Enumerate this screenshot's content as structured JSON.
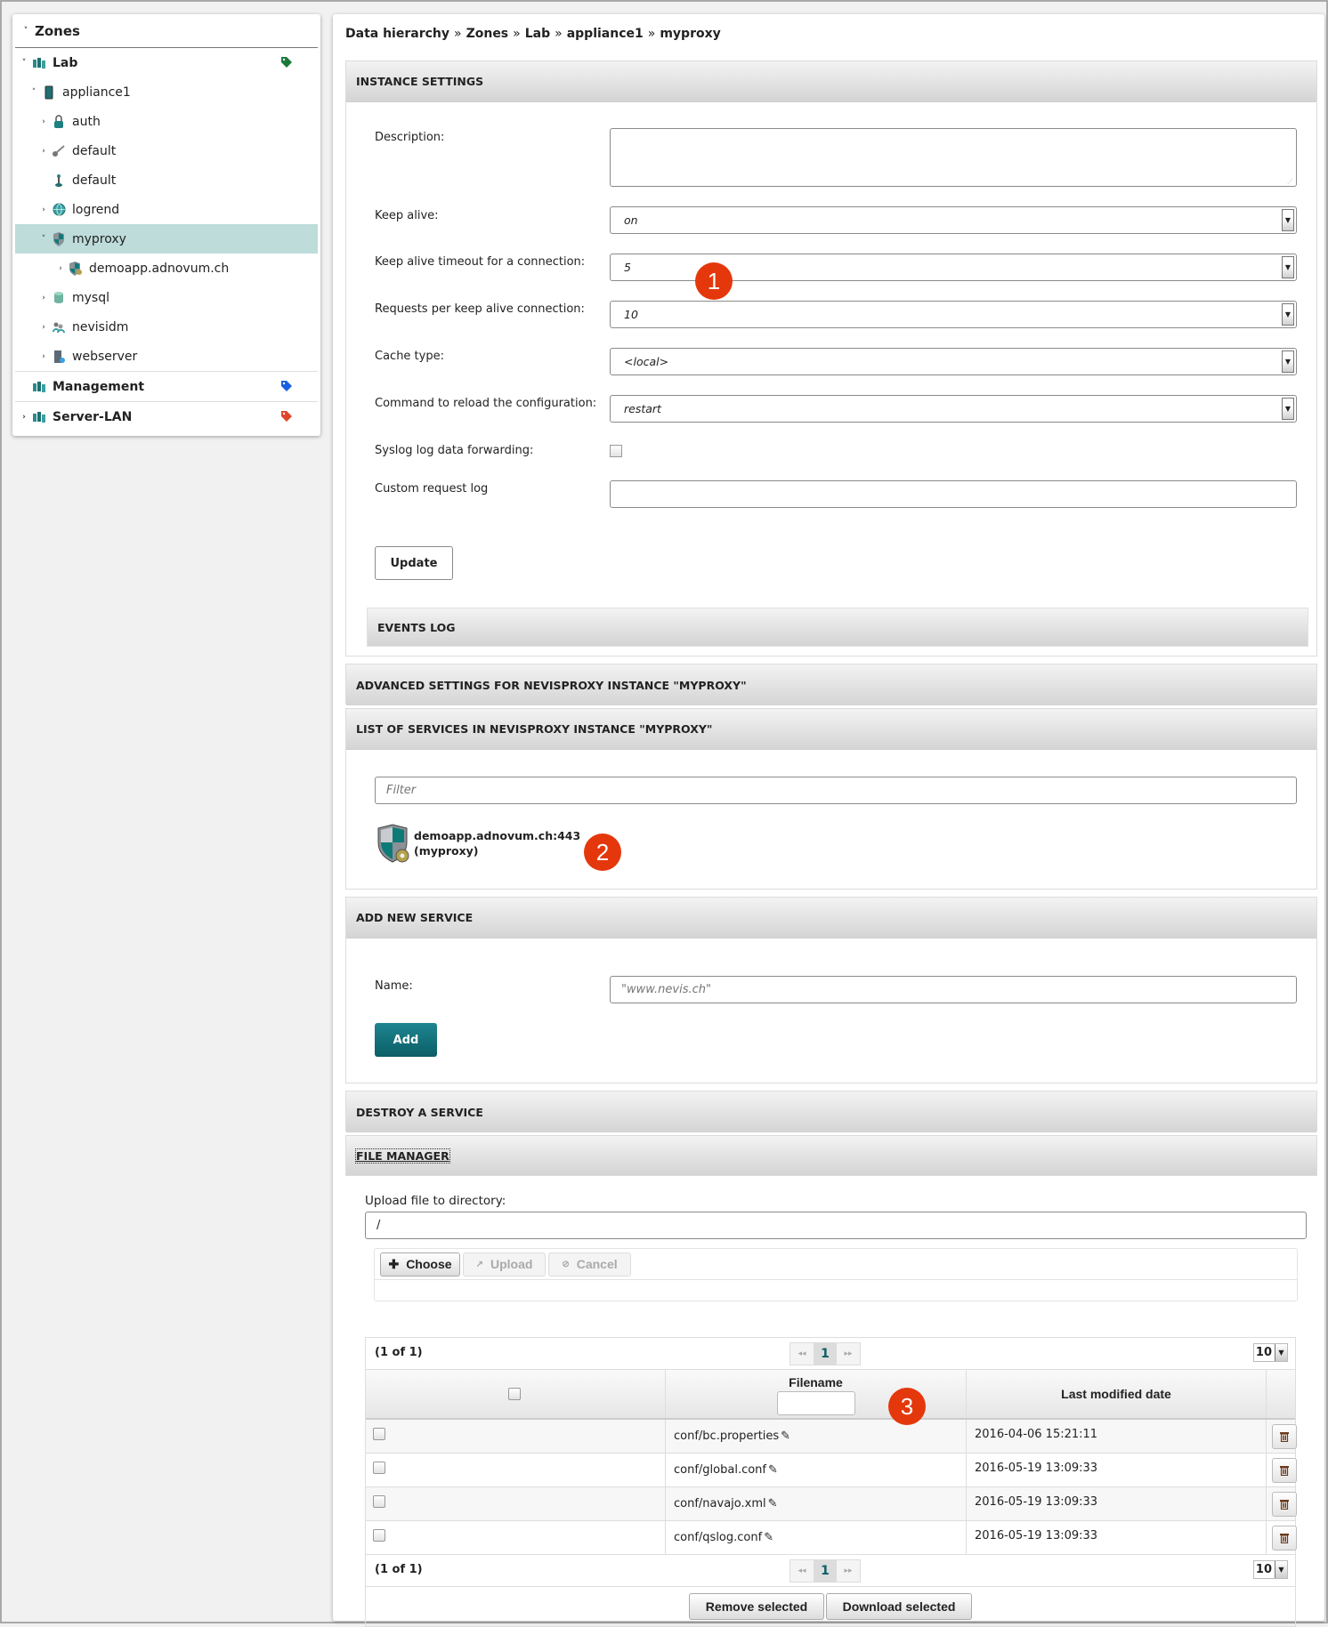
{
  "sidebar": {
    "title": "Zones",
    "items": [
      {
        "label": "Lab",
        "level": 0,
        "caret": "down",
        "icon": "zone-icon",
        "bold": true,
        "tag": "#1b7a3a"
      },
      {
        "label": "appliance1",
        "level": 1,
        "caret": "down",
        "icon": "appliance-icon"
      },
      {
        "label": "auth",
        "level": 2,
        "caret": "right",
        "icon": "lock-icon"
      },
      {
        "label": "default",
        "level": 2,
        "caret": "right",
        "icon": "key-icon"
      },
      {
        "label": "default",
        "level": 2,
        "caret": "",
        "icon": "joystick-icon"
      },
      {
        "label": "logrend",
        "level": 2,
        "caret": "right",
        "icon": "globe-icon"
      },
      {
        "label": "myproxy",
        "level": 2,
        "caret": "down",
        "icon": "shield-icon",
        "selected": true
      },
      {
        "label": "demoapp.adnovum.ch",
        "level": 3,
        "caret": "right",
        "icon": "shield-gear-icon"
      },
      {
        "label": "mysql",
        "level": 2,
        "caret": "right",
        "icon": "database-icon"
      },
      {
        "label": "nevisidm",
        "level": 2,
        "caret": "right",
        "icon": "users-icon"
      },
      {
        "label": "webserver",
        "level": 2,
        "caret": "right",
        "icon": "server-icon"
      },
      {
        "label": "Management",
        "level": 0,
        "caret": "",
        "icon": "zone-icon",
        "bold": true,
        "tag": "#1a5fe0",
        "sep": true
      },
      {
        "label": "Server-LAN",
        "level": 0,
        "caret": "right",
        "icon": "zone-icon",
        "bold": true,
        "tag": "#e0442a",
        "sep": true
      }
    ]
  },
  "breadcrumb": [
    "Data hierarchy",
    "Zones",
    "Lab",
    "appliance1",
    "myproxy"
  ],
  "breadcrumb_sep": "»",
  "instance_settings": {
    "title": "INSTANCE SETTINGS",
    "description_label": "Description:",
    "description_value": "",
    "keep_alive_label": "Keep alive:",
    "keep_alive_value": "on",
    "keep_alive_timeout_label": "Keep alive timeout for a connection:",
    "keep_alive_timeout_value": "5",
    "requests_label": "Requests per keep alive connection:",
    "requests_value": "10",
    "cache_label": "Cache type:",
    "cache_value": "<local>",
    "reload_label": "Command to reload the configuration:",
    "reload_value": "restart",
    "syslog_label": "Syslog log data forwarding:",
    "syslog_checked": false,
    "custom_log_label": "Custom request log",
    "custom_log_value": "",
    "update_label": "Update",
    "events_log_title": "EVENTS LOG"
  },
  "advanced_title": "ADVANCED SETTINGS FOR NEVISPROXY INSTANCE \"MYPROXY\"",
  "services": {
    "title": "LIST OF SERVICES IN NEVISPROXY INSTANCE \"MYPROXY\"",
    "filter_placeholder": "Filter",
    "items": [
      {
        "name": "demoapp.adnovum.ch:443",
        "instance": "(myproxy)"
      }
    ]
  },
  "add_service": {
    "title": "ADD NEW SERVICE",
    "name_label": "Name:",
    "name_placeholder": "\"www.nevis.ch\"",
    "add_label": "Add",
    "accent": "#0f6770"
  },
  "destroy_title": "DESTROY A SERVICE",
  "file_manager": {
    "title": "FILE MANAGER",
    "upload_label": "Upload file to directory:",
    "directory_value": "/",
    "choose_label": "Choose",
    "upload_btn": "Upload",
    "cancel_btn": "Cancel",
    "page_info": "(1 of 1)",
    "current_page": "1",
    "per_page": "10",
    "columns": [
      "",
      "Filename",
      "Last modified date",
      ""
    ],
    "rows": [
      {
        "filename": "conf/bc.properties",
        "modified": "2016-04-06 15:21:11"
      },
      {
        "filename": "conf/global.conf",
        "modified": "2016-05-19 13:09:33"
      },
      {
        "filename": "conf/navajo.xml",
        "modified": "2016-05-19 13:09:33"
      },
      {
        "filename": "conf/qslog.conf",
        "modified": "2016-05-19 13:09:33"
      }
    ],
    "remove_selected": "Remove selected",
    "download_selected": "Download selected"
  },
  "annotations": [
    "1",
    "2",
    "3"
  ]
}
